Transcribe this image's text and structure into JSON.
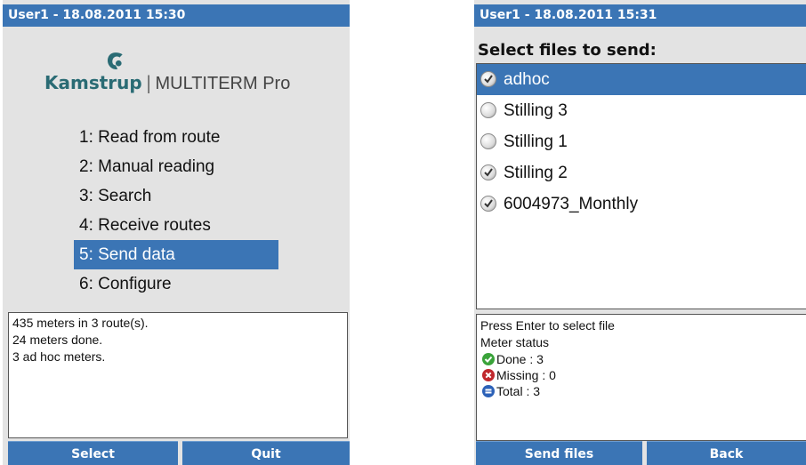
{
  "left_screen": {
    "title": "User1 - 18.08.2011 15:30",
    "logo": {
      "brand": "Kamstrup",
      "separator": "|",
      "product": "MULTITERM Pro",
      "icon": "kamstrup-logo-icon",
      "brand_color": "#2a6b74"
    },
    "menu": [
      {
        "label": "1: Read from route",
        "selected": false
      },
      {
        "label": "2: Manual reading",
        "selected": false
      },
      {
        "label": "3: Search",
        "selected": false
      },
      {
        "label": "4: Receive routes",
        "selected": false
      },
      {
        "label": "5: Send data",
        "selected": true
      },
      {
        "label": "6: Configure",
        "selected": false
      }
    ],
    "status_lines": [
      "435 meters in 3 route(s).",
      "24 meters done.",
      "3 ad hoc meters."
    ],
    "softkeys": {
      "left": "Select",
      "right": "Quit"
    }
  },
  "right_screen": {
    "title": "User1 - 18.08.2011 15:31",
    "heading": "Select files to send:",
    "files": [
      {
        "name": "adhoc",
        "checked": true,
        "selected": true
      },
      {
        "name": "Stilling 3",
        "checked": false,
        "selected": false
      },
      {
        "name": "Stilling 1",
        "checked": false,
        "selected": false
      },
      {
        "name": "Stilling 2",
        "checked": true,
        "selected": false
      },
      {
        "name": "6004973_Monthly",
        "checked": true,
        "selected": false
      }
    ],
    "status": {
      "instruction": "Press Enter to select file",
      "meter_status_label": "Meter status",
      "items": [
        {
          "label": "Done : 3",
          "icon": "check-circle-icon",
          "color": "#3aa33a"
        },
        {
          "label": "Missing : 0",
          "icon": "x-circle-icon",
          "color": "#c0282d"
        },
        {
          "label": "Total : 3",
          "icon": "equals-circle-icon",
          "color": "#2d62b8"
        }
      ]
    },
    "softkeys": {
      "left": "Send files",
      "right": "Back"
    }
  },
  "colors": {
    "accent": "#3b75b5",
    "background": "#e3e3e3"
  }
}
